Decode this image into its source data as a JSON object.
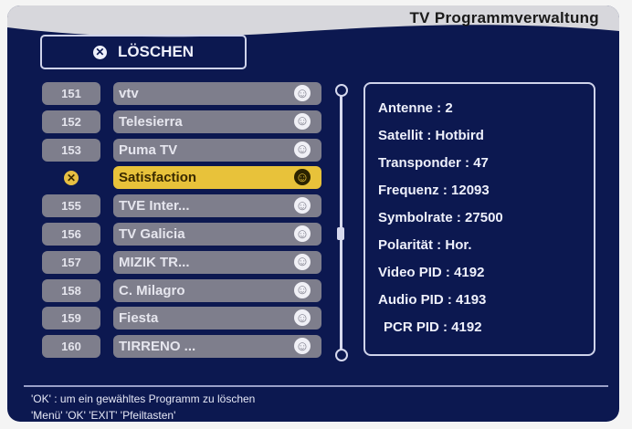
{
  "header": {
    "title": "TV Programmverwaltung"
  },
  "action": {
    "icon": "close-circle-icon",
    "label": "LÖSCHEN"
  },
  "channels": [
    {
      "number": "151",
      "name": "vtv"
    },
    {
      "number": "152",
      "name": "Telesierra"
    },
    {
      "number": "153",
      "name": "Puma TV"
    },
    {
      "number": "",
      "name": "Satisfaction",
      "selected": true,
      "marked": true
    },
    {
      "number": "155",
      "name": "TVE Inter..."
    },
    {
      "number": "156",
      "name": "TV Galicia"
    },
    {
      "number": "157",
      "name": "MIZIK TR..."
    },
    {
      "number": "158",
      "name": "C. Milagro"
    },
    {
      "number": "159",
      "name": "Fiesta"
    },
    {
      "number": "160",
      "name": "TIRRENO ..."
    }
  ],
  "info": [
    {
      "label": "Antenne",
      "value": "2"
    },
    {
      "label": "Satellit",
      "value": "Hotbird"
    },
    {
      "label": "Transponder",
      "value": "47"
    },
    {
      "label": "Frequenz",
      "value": "12093"
    },
    {
      "label": "Symbolrate",
      "value": "27500"
    },
    {
      "label": "Polarität",
      "value": "Hor."
    },
    {
      "label": "Video PID",
      "value": "4192"
    },
    {
      "label": "Audio PID",
      "value": "4193"
    },
    {
      "label": "PCR  PID",
      "value": "4192"
    }
  ],
  "footer": {
    "line1": "'OK' : um ein gewähltes Programm zu löschen",
    "line2": "'Menü' 'OK' 'EXIT' 'Pfeiltasten'"
  },
  "colors": {
    "screen": "#0c1850",
    "selected": "#e8c23a",
    "row": "#7e7e8c"
  }
}
